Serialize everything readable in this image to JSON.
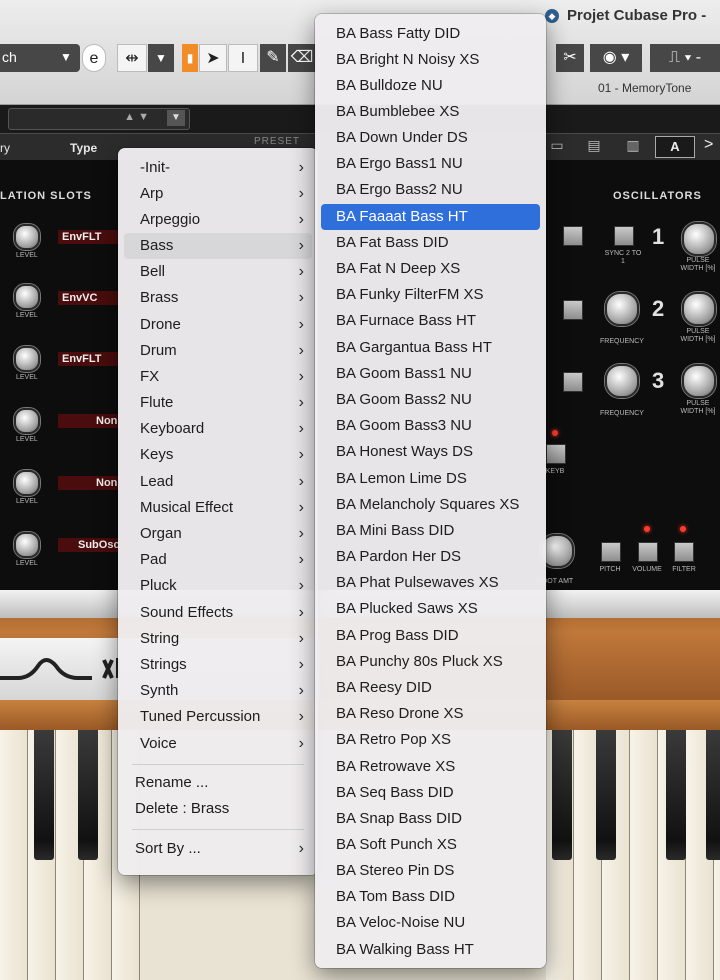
{
  "window": {
    "title": "Projet Cubase Pro -"
  },
  "toolbar": {
    "dropdown_text": "ch",
    "track_label": "01 - MemoryTone"
  },
  "plugin": {
    "left_label": "ry",
    "type_label": "Type",
    "preset_label": "PRESET",
    "preset_slot": "A",
    "modulation_title": "LATION SLOTS",
    "oscillators_title": "OSCILLATORS",
    "slots": [
      "EnvFLT",
      "EnvVC",
      "EnvFLT",
      "Non",
      "Non",
      "SubOsc"
    ],
    "knob_caption": "LEVEL",
    "osc_numbers": [
      "1",
      "2",
      "3"
    ],
    "captions": {
      "sync": "SYNC 2 TO 1",
      "pulse": "PULSE WIDTH [%]",
      "frequency": "FREQUENCY",
      "keyb": "KEYB",
      "root_amt": "ROOT AMT",
      "pitch": "PITCH",
      "volume": "VOLUME",
      "filter": "FILTER"
    }
  },
  "category_menu": {
    "items": [
      {
        "label": "-Init-"
      },
      {
        "label": "Arp"
      },
      {
        "label": "Arpeggio"
      },
      {
        "label": "Bass"
      },
      {
        "label": "Bell"
      },
      {
        "label": "Brass"
      },
      {
        "label": "Drone"
      },
      {
        "label": "Drum"
      },
      {
        "label": "FX"
      },
      {
        "label": "Flute"
      },
      {
        "label": "Keyboard"
      },
      {
        "label": "Keys"
      },
      {
        "label": "Lead"
      },
      {
        "label": "Musical Effect"
      },
      {
        "label": "Organ"
      },
      {
        "label": "Pad"
      },
      {
        "label": "Pluck"
      },
      {
        "label": "Sound Effects"
      },
      {
        "label": "String"
      },
      {
        "label": "Strings"
      },
      {
        "label": "Synth"
      },
      {
        "label": "Tuned Percussion"
      },
      {
        "label": "Voice"
      }
    ],
    "highlighted": "Bass",
    "actions": {
      "rename": "Rename ...",
      "delete": "Delete  : Brass",
      "sort_by": "Sort By ..."
    }
  },
  "preset_menu": {
    "items": [
      "BA Bass Fatty DID",
      "BA Bright N Noisy XS",
      "BA Bulldoze NU",
      "BA Bumblebee XS",
      "BA Down Under DS",
      "BA Ergo Bass1 NU",
      "BA Ergo Bass2 NU",
      "BA Faaaat Bass HT",
      "BA Fat Bass DID",
      "BA Fat N Deep XS",
      "BA Funky FilterFM XS",
      "BA Furnace Bass HT",
      "BA Gargantua Bass HT",
      "BA Goom Bass1 NU",
      "BA Goom Bass2 NU",
      "BA Goom Bass3 NU",
      "BA Honest Ways DS",
      "BA Lemon Lime DS",
      "BA Melancholy Squares XS",
      "BA Mini Bass DID",
      "BA Pardon Her DS",
      "BA Phat Pulsewaves XS",
      "BA Plucked Saws XS",
      "BA Prog Bass DID",
      "BA Punchy 80s Pluck XS",
      "BA Reesy DID",
      "BA Reso Drone XS",
      "BA Retro Pop XS",
      "BA Retrowave XS",
      "BA Seq Bass DID",
      "BA Snap Bass DID",
      "BA Soft Punch XS",
      "BA Stereo Pin DS",
      "BA Tom Bass DID",
      "BA Veloc-Noise NU",
      "BA Walking Bass HT"
    ],
    "highlighted": "BA Faaaat Bass HT"
  },
  "colors": {
    "menu_highlight": "#2f6fdc",
    "toolbar_accent": "#f28c28"
  }
}
